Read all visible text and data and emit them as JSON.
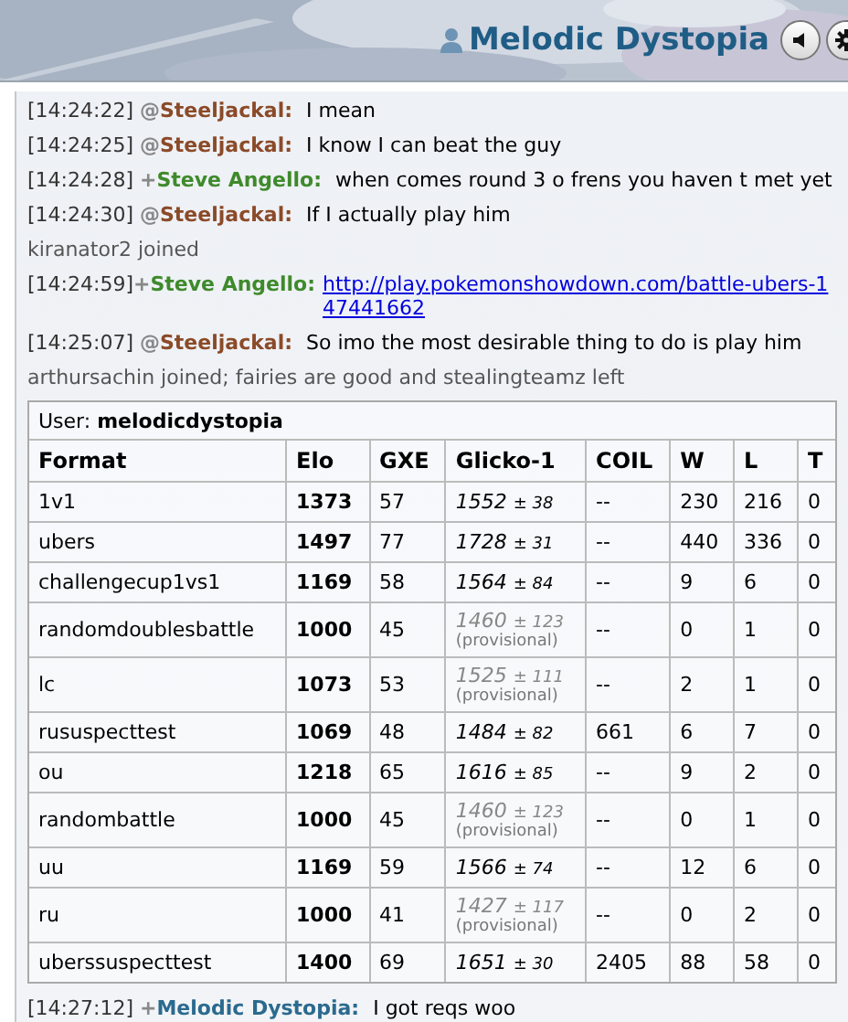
{
  "header": {
    "username": "Melodic Dystopia"
  },
  "messages": [
    {
      "kind": "chat",
      "time": "[14:24:22]",
      "rank": "@",
      "name": "Steeljackal:",
      "color": "#8b4a28",
      "text": "I mean"
    },
    {
      "kind": "chat",
      "time": "[14:24:25]",
      "rank": "@",
      "name": "Steeljackal:",
      "color": "#8b4a28",
      "text": "I know I can beat the guy"
    },
    {
      "kind": "chat",
      "time": "[14:24:28]",
      "rank": "+",
      "name": "Steve Angello:",
      "color": "#3f8a2c",
      "text": "when comes round 3 o frens you haven t met yet"
    },
    {
      "kind": "chat",
      "time": "[14:24:30]",
      "rank": "@",
      "name": "Steeljackal:",
      "color": "#8b4a28",
      "text": "If I actually play him"
    },
    {
      "kind": "system",
      "text": "kiranator2 joined"
    },
    {
      "kind": "link",
      "time": "[14:24:59]",
      "rank": "+",
      "name": "Steve Angello:",
      "color": "#3f8a2c",
      "text": "http://play.pokemonshowdown.com/battle-ubers-147441662"
    },
    {
      "kind": "chat",
      "time": "[14:25:07]",
      "rank": "@",
      "name": "Steeljackal:",
      "color": "#8b4a28",
      "text": "So imo the most desirable thing to do is play him"
    },
    {
      "kind": "system",
      "text": "arthursachin joined; fairies are good and stealingteamz left"
    },
    {
      "kind": "ladder",
      "user_label": "User:",
      "user": "melodicdystopia",
      "columns": [
        "Format",
        "Elo",
        "GXE",
        "Glicko-1",
        "COIL",
        "W",
        "L",
        "T"
      ],
      "rows": [
        {
          "format": "1v1",
          "elo": "1373",
          "gxe": "57",
          "glicko": "1552",
          "deviation": "± 38",
          "provisional": false,
          "coil": "--",
          "w": "230",
          "l": "216",
          "t": "0"
        },
        {
          "format": "ubers",
          "elo": "1497",
          "gxe": "77",
          "glicko": "1728",
          "deviation": "± 31",
          "provisional": false,
          "coil": "--",
          "w": "440",
          "l": "336",
          "t": "0"
        },
        {
          "format": "challengecup1vs1",
          "elo": "1169",
          "gxe": "58",
          "glicko": "1564",
          "deviation": "± 84",
          "provisional": false,
          "coil": "--",
          "w": "9",
          "l": "6",
          "t": "0"
        },
        {
          "format": "randomdoublesbattle",
          "elo": "1000",
          "gxe": "45",
          "glicko": "1460",
          "deviation": "± 123",
          "provisional": true,
          "provisional_label": "(provisional)",
          "coil": "--",
          "w": "0",
          "l": "1",
          "t": "0"
        },
        {
          "format": "lc",
          "elo": "1073",
          "gxe": "53",
          "glicko": "1525",
          "deviation": "± 111",
          "provisional": true,
          "provisional_label": "(provisional)",
          "coil": "--",
          "w": "2",
          "l": "1",
          "t": "0"
        },
        {
          "format": "rususpecttest",
          "elo": "1069",
          "gxe": "48",
          "glicko": "1484",
          "deviation": "± 82",
          "provisional": false,
          "coil": "661",
          "w": "6",
          "l": "7",
          "t": "0"
        },
        {
          "format": "ou",
          "elo": "1218",
          "gxe": "65",
          "glicko": "1616",
          "deviation": "± 85",
          "provisional": false,
          "coil": "--",
          "w": "9",
          "l": "2",
          "t": "0"
        },
        {
          "format": "randombattle",
          "elo": "1000",
          "gxe": "45",
          "glicko": "1460",
          "deviation": "± 123",
          "provisional": true,
          "provisional_label": "(provisional)",
          "coil": "--",
          "w": "0",
          "l": "1",
          "t": "0"
        },
        {
          "format": "uu",
          "elo": "1169",
          "gxe": "59",
          "glicko": "1566",
          "deviation": "± 74",
          "provisional": false,
          "coil": "--",
          "w": "12",
          "l": "6",
          "t": "0"
        },
        {
          "format": "ru",
          "elo": "1000",
          "gxe": "41",
          "glicko": "1427",
          "deviation": "± 117",
          "provisional": true,
          "provisional_label": "(provisional)",
          "coil": "--",
          "w": "0",
          "l": "2",
          "t": "0"
        },
        {
          "format": "uberssuspecttest",
          "elo": "1400",
          "gxe": "69",
          "glicko": "1651",
          "deviation": "± 30",
          "provisional": false,
          "coil": "2405",
          "w": "88",
          "l": "58",
          "t": "0"
        }
      ]
    },
    {
      "kind": "chat",
      "time": "[14:27:12]",
      "rank": "+",
      "name": "Melodic Dystopia:",
      "color": "#2b6a8f",
      "text": "I got reqs woo"
    }
  ]
}
